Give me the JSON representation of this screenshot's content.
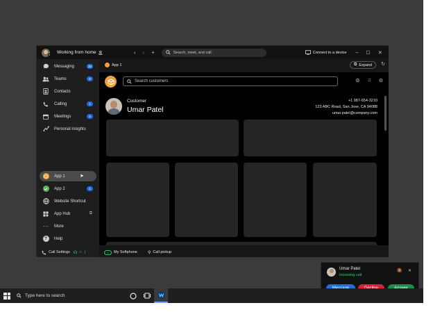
{
  "window": {
    "presence_status": "Working from home",
    "presence_emoji": "🏝",
    "search_placeholder": "Search, meet, and call",
    "connect_label": "Connect to a device"
  },
  "sidebar": {
    "items": [
      {
        "label": "Messaging",
        "badge": "20"
      },
      {
        "label": "Teams",
        "badge": "8"
      },
      {
        "label": "Contacts"
      },
      {
        "label": "Calling",
        "badge": "1"
      },
      {
        "label": "Meetings",
        "badge": "4"
      },
      {
        "label": "Personal insights"
      }
    ],
    "apps": [
      {
        "label": "App 1"
      },
      {
        "label": "App 2",
        "badge": "1"
      },
      {
        "label": "Website Shortcut"
      },
      {
        "label": "App Hub"
      },
      {
        "label": "More"
      },
      {
        "label": "Help"
      }
    ],
    "call_settings": "Call Settings"
  },
  "content": {
    "tab_label": "App 1",
    "expand_label": "Expand",
    "customer_search_placeholder": "Search customers",
    "customer_label": "Customer",
    "customer_name": "Umar Patel",
    "phone": "+1 987-654-3210",
    "address": "123 ABC Road, San Jose, CA 94088",
    "email": "umar.patel@company.com"
  },
  "bottom": {
    "softphone_label": "My Softphone",
    "pickup_label": "Call pickup"
  },
  "toast": {
    "caller_name": "Umar Patel",
    "status": "Incoming call",
    "message_label": "Message",
    "decline_label": "Decline",
    "answer_label": "Answer"
  },
  "taskbar": {
    "search_placeholder": "Type here to search"
  },
  "colors": {
    "accent_blue": "#1f6fd8",
    "decline_red": "#d9223a",
    "answer_green": "#1d8a4e",
    "presence_green": "#24c15a",
    "app_orange": "#f2a03a",
    "app2_green": "#5bb85d"
  }
}
